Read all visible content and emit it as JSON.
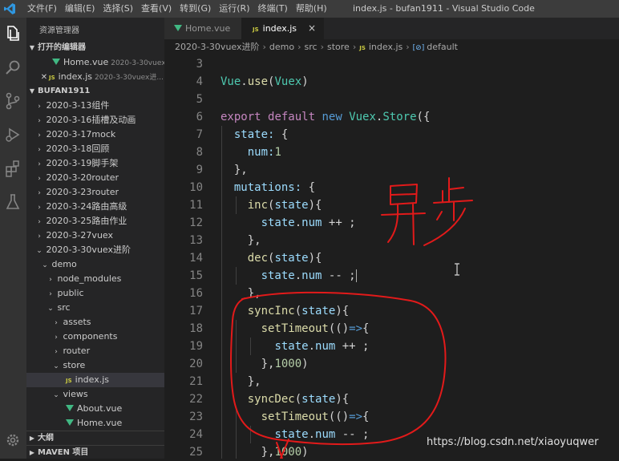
{
  "titlebar": {
    "menus": [
      "文件(F)",
      "编辑(E)",
      "选择(S)",
      "查看(V)",
      "转到(G)",
      "运行(R)",
      "终端(T)",
      "帮助(H)"
    ],
    "title": "index.js - bufan1911 - Visual Studio Code"
  },
  "sidebar": {
    "title": "资源管理器",
    "open_editors_header": "打开的编辑器",
    "open_editors": [
      {
        "name": "Home.vue",
        "desc": "2020-3-30vuex..."
      },
      {
        "name": "index.js",
        "desc": "2020-3-30vuex进..."
      }
    ],
    "project_header": "BUFAN1911",
    "tree": [
      {
        "label": "2020-3-13组件",
        "chevron": "›"
      },
      {
        "label": "2020-3-16插槽及动画",
        "chevron": "›"
      },
      {
        "label": "2020-3-17mock",
        "chevron": "›"
      },
      {
        "label": "2020-3-18回顾",
        "chevron": "›"
      },
      {
        "label": "2020-3-19脚手架",
        "chevron": "›"
      },
      {
        "label": "2020-3-20router",
        "chevron": "›"
      },
      {
        "label": "2020-3-23router",
        "chevron": "›"
      },
      {
        "label": "2020-3-24路由高级",
        "chevron": "›"
      },
      {
        "label": "2020-3-25路由作业",
        "chevron": "›"
      },
      {
        "label": "2020-3-27vuex",
        "chevron": "›"
      },
      {
        "label": "2020-3-30vuex进阶",
        "chevron": "⌄"
      },
      {
        "label": "demo",
        "chevron": "⌄"
      },
      {
        "label": "node_modules",
        "chevron": "›"
      },
      {
        "label": "public",
        "chevron": "›"
      },
      {
        "label": "src",
        "chevron": "⌄"
      },
      {
        "label": "assets",
        "chevron": "›"
      },
      {
        "label": "components",
        "chevron": "›"
      },
      {
        "label": "router",
        "chevron": "›"
      },
      {
        "label": "store",
        "chevron": "⌄"
      },
      {
        "label": "index.js",
        "icon": "JS"
      },
      {
        "label": "views",
        "chevron": "⌄"
      },
      {
        "label": "About.vue",
        "icon": "vue"
      },
      {
        "label": "Home.vue",
        "icon": "vue"
      }
    ],
    "outline_header": "大纲",
    "maven_header": "MAVEN 项目"
  },
  "tabs": [
    {
      "label": "Home.vue",
      "icon": "vue"
    },
    {
      "label": "index.js",
      "icon": "JS",
      "close": "×"
    }
  ],
  "breadcrumb": {
    "items": [
      "2020-3-30vuex进阶",
      "demo",
      "src",
      "store",
      "index.js",
      "default"
    ],
    "separator": "›"
  },
  "editor": {
    "line_numbers": [
      "3",
      "4",
      "5",
      "6",
      "7",
      "8",
      "9",
      "10",
      "11",
      "12",
      "13",
      "14",
      "15",
      "16",
      "17",
      "18",
      "19",
      "20",
      "21",
      "22",
      "23",
      "24",
      "25"
    ]
  },
  "watermark": "https://blog.csdn.net/xiaoyuqwer",
  "colors": {
    "keyword": "#569cd6",
    "control": "#c586c0",
    "function": "#dcdcaa",
    "class": "#4ec9b0",
    "property": "#9cdcfe",
    "number": "#b5cea8",
    "annotation": "#e21a1a"
  }
}
